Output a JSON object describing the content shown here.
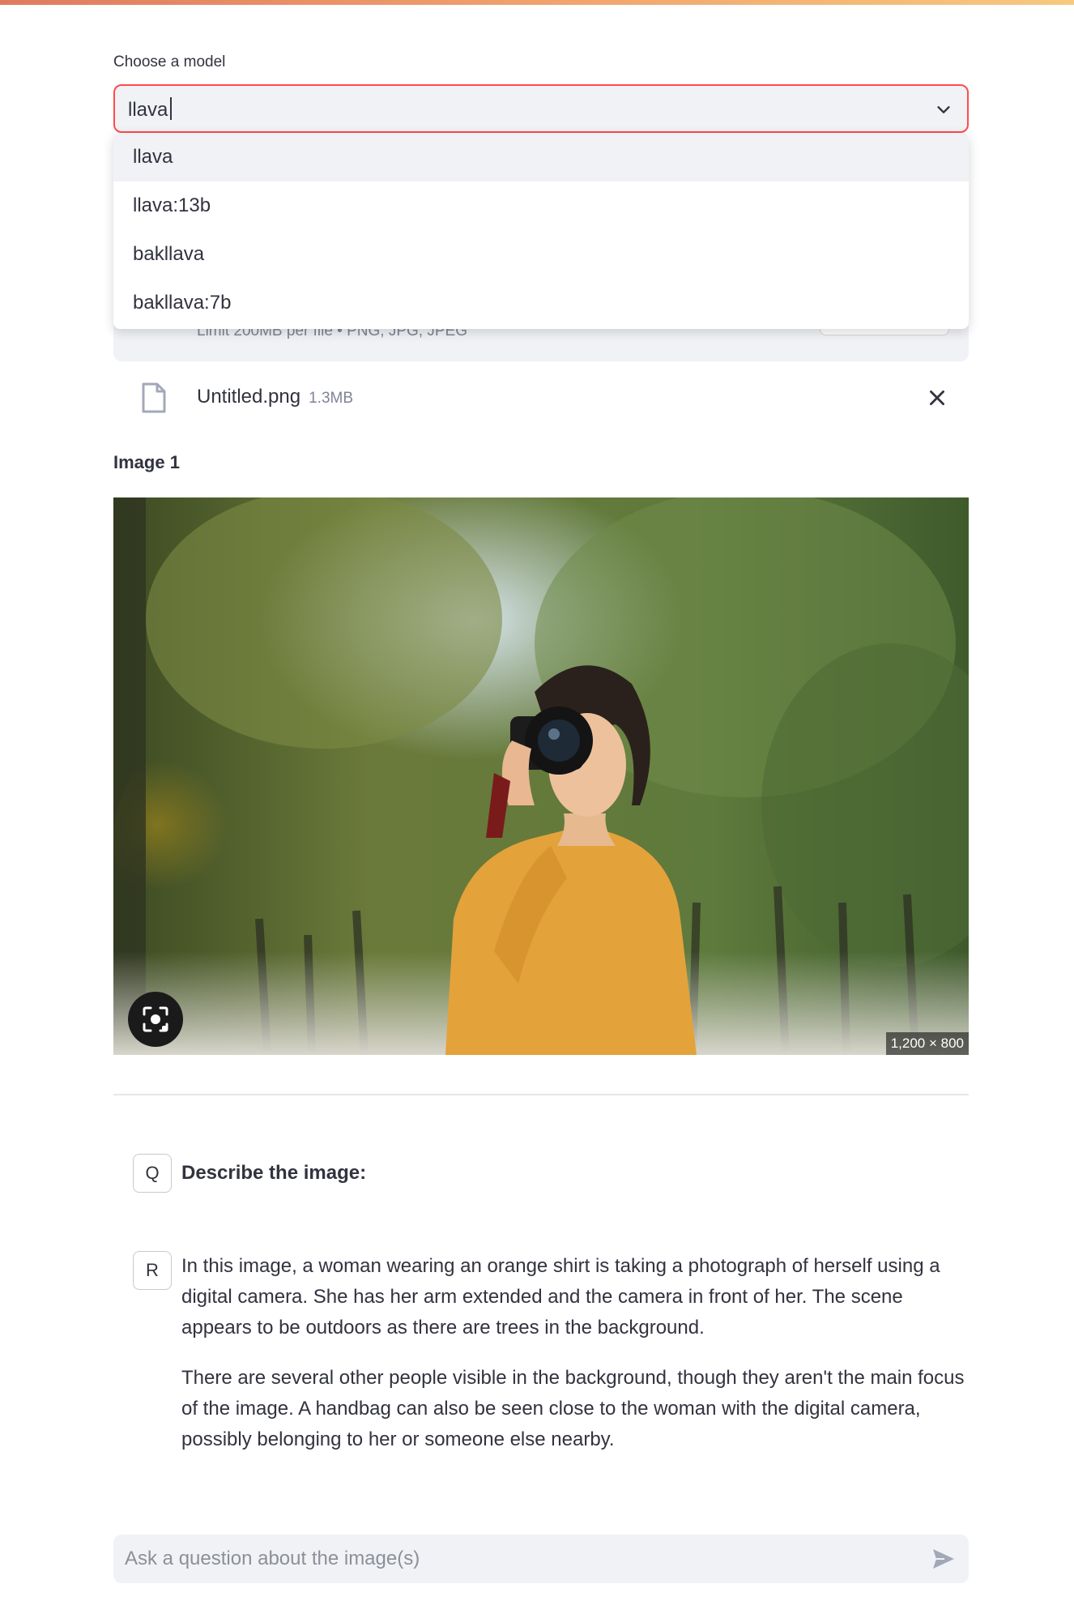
{
  "model_select": {
    "label": "Choose a model",
    "current_value": "llava",
    "options": [
      "llava",
      "llava:13b",
      "bakllava",
      "bakllava:7b"
    ]
  },
  "uploader": {
    "limit_text": "Limit 200MB per file • PNG, JPG, JPEG"
  },
  "uploaded_file": {
    "name": "Untitled.png",
    "size": "1.3MB"
  },
  "image_section": {
    "heading": "Image 1",
    "dimensions": "1,200 × 800"
  },
  "conversation": {
    "question_avatar": "Q",
    "question": "Describe the image:",
    "response_avatar": "R",
    "response_paragraphs": [
      "In this image, a woman wearing an orange shirt is taking a photograph of herself using a digital camera. She has her arm extended and the camera in front of her. The scene appears to be outdoors as there are trees in the background.",
      "There are several other people visible in the background, though they aren't the main focus of the image. A handbag can also be seen close to the woman with the digital camera, possibly belonging to her or someone else nearby."
    ]
  },
  "chat_input": {
    "placeholder": "Ask a question about the image(s)"
  },
  "colors": {
    "accent": "#ff4b4b",
    "input_bg": "#f0f2f6",
    "text": "#31333f",
    "muted": "#808495"
  },
  "icons": [
    "chevron-down-icon",
    "file-icon",
    "close-icon",
    "lens-icon",
    "send-icon"
  ]
}
